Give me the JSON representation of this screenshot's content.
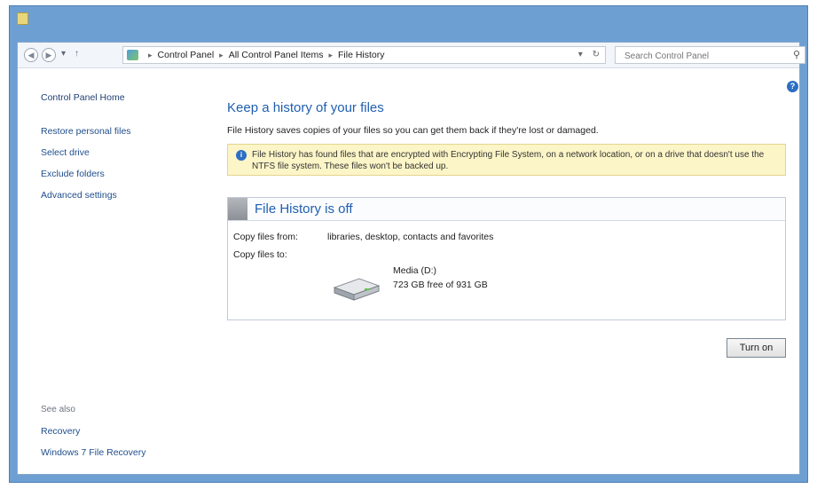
{
  "addressbar": {
    "breadcrumbs": [
      "Control Panel",
      "All Control Panel Items",
      "File History"
    ],
    "search_placeholder": "Search Control Panel"
  },
  "sidebar": {
    "home": "Control Panel Home",
    "links": [
      "Restore personal files",
      "Select drive",
      "Exclude folders",
      "Advanced settings"
    ],
    "see_also_caption": "See also",
    "see_also_links": [
      "Recovery",
      "Windows 7 File Recovery"
    ]
  },
  "main": {
    "title": "Keep a history of your files",
    "description": "File History saves copies of your files so you can get them back if they're lost or damaged.",
    "info_message": "File History has found files that are encrypted with Encrypting File System, on a network location, or on a drive that doesn't use the NTFS file system. These files won't be backed up.",
    "status": {
      "title": "File History is off",
      "copy_from_label": "Copy files from:",
      "copy_from_value": "libraries, desktop, contacts and favorites",
      "copy_to_label": "Copy files to:",
      "drive_name": "Media (D:)",
      "drive_space": "723 GB free of 931 GB"
    },
    "turn_on_label": "Turn on"
  },
  "icons": {
    "back": "back-arrow-icon",
    "forward": "forward-arrow-icon",
    "recent": "chevron-down-icon",
    "up": "up-arrow-icon",
    "location": "control-panel-icon",
    "refresh": "refresh-icon",
    "search": "search-icon",
    "help": "help-icon",
    "info": "info-icon",
    "drive": "hard-drive-icon"
  },
  "colors": {
    "title_bar": "#6d9fd3",
    "link": "#1f4e8c",
    "heading": "#1f5fb0",
    "info_bar": "#fcf5c7"
  }
}
